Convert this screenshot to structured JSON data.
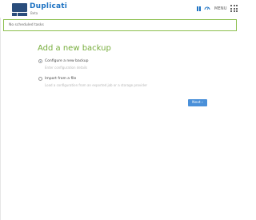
{
  "app": {
    "name": "Duplicati",
    "subtitle": "Beta",
    "menu_label": "MENU",
    "icons": [
      "pause-icon",
      "throttle-icon",
      "menu-grid-icon"
    ]
  },
  "status": {
    "text": "No scheduled tasks"
  },
  "page": {
    "title": "Add a new backup"
  },
  "options": [
    {
      "label": "Configure a new backup",
      "description": "Enter configuration details",
      "selected": true
    },
    {
      "label": "Import from a file",
      "description": "Load a configuration from an exported job or a storage provider",
      "selected": false
    }
  ],
  "actions": {
    "next_label": "Next ›"
  },
  "colors": {
    "brand_blue": "#1d72c2",
    "logo_navy": "#2a4d7c",
    "accent_green": "#77ad3c",
    "status_border": "#8bbf4e",
    "button_blue": "#4a90d9"
  }
}
